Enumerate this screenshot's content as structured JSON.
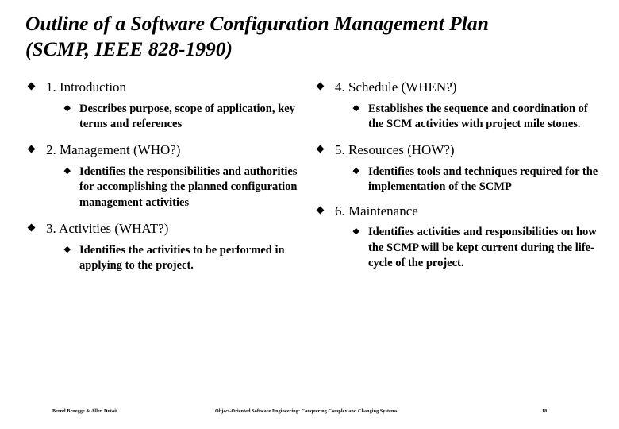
{
  "slide": {
    "title_lines": [
      "Outline of a Software Configuration Management Plan",
      "(SCMP, IEEE 828-1990)"
    ],
    "bullet_glyph": "diamond",
    "left_column": [
      {
        "level1": "1. Introduction",
        "level2": [
          "Describes purpose, scope of application, key terms and references"
        ]
      },
      {
        "level1": "2. Management (WHO?)",
        "level2": [
          "Identifies the responsibilities and authorities for accomplishing the planned configuration management activities"
        ]
      },
      {
        "level1": "3. Activities (WHAT?)",
        "level2": [
          "Identifies the activities to be performed in applying to the project."
        ]
      }
    ],
    "right_column": [
      {
        "level1": "4. Schedule (WHEN?)",
        "level2": [
          "Establishes the sequence and coordination of the SCM activities with project mile stones."
        ]
      },
      {
        "level1": "5. Resources (HOW?)",
        "level2": [
          "Identifies tools and techniques required for the implementation of the SCMP"
        ]
      },
      {
        "level1": "6. Maintenance",
        "level2": [
          "Identifies activities and responsibilities on how the SCMP will be kept current during the life-cycle of the project."
        ]
      }
    ]
  },
  "footer": {
    "author": "Bernd Bruegge & Allen Dutoit",
    "book": "Object-Oriented Software Engineering: Conquering Complex and Changing Systems",
    "page": "18"
  },
  "colors": {
    "background": "#ffffff",
    "text": "#000000"
  }
}
